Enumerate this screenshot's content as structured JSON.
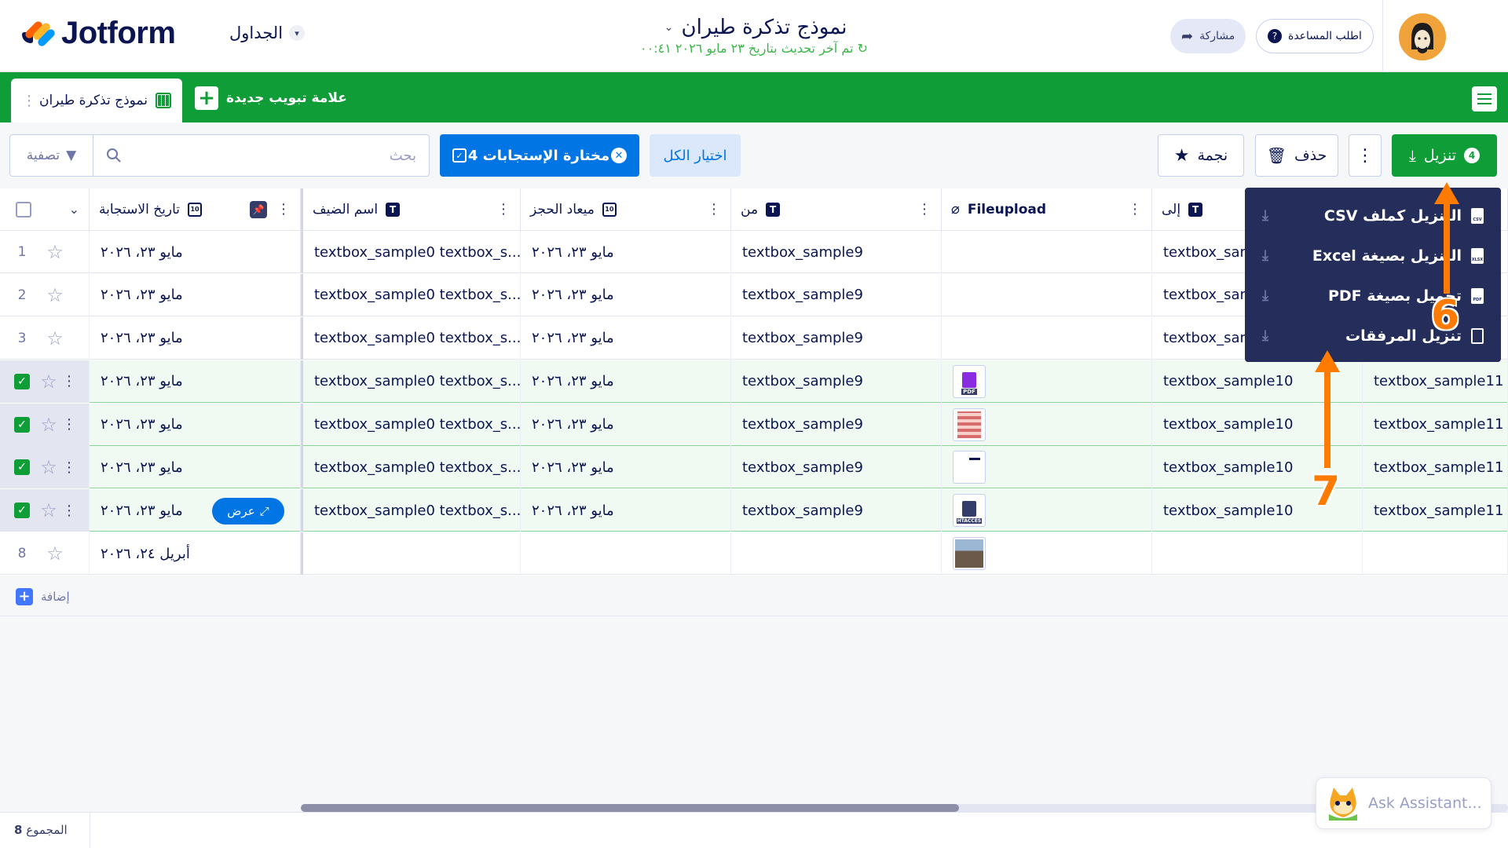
{
  "header": {
    "brand": "Jotform",
    "tables_menu": "الجداول",
    "form_title": "نموذج تذكرة طيران",
    "last_updated": "تم آخر تحديث بتاريخ ٢٣ مايو ٢٠٢٦ ٠٠:٤١",
    "share_label": "مشاركة",
    "help_label": "اطلب المساعدة"
  },
  "tabs": {
    "active_tab": "نموذج تذكرة طيران",
    "new_tab": "علامة تبويب جديدة"
  },
  "toolbar": {
    "search_placeholder": "بحث",
    "filter_label": "تصفية",
    "selected_label": "مختارة الإستجابات 4",
    "select_all_label": "اختيار الكل",
    "star_label": "نجمة",
    "delete_label": "حذف",
    "download_label": "تنزيل",
    "download_badge": "4"
  },
  "columns": {
    "response_date": "تاريخ الاستجابة",
    "guest_name": "اسم الضيف",
    "booking_date": "ميعاد الحجز",
    "from": "من",
    "fileupload": "Fileupload",
    "to": "إلى"
  },
  "rows": [
    {
      "num": "1",
      "date": "مايو ٢٣، ٢٠٢٦",
      "guest": "textbox_sample0 textbox_s...",
      "booking": "مايو ٢٣، ٢٠٢٦",
      "from": "textbox_sample9",
      "file": "",
      "to": "textbox_sam",
      "to2": "",
      "selected": false
    },
    {
      "num": "2",
      "date": "مايو ٢٣، ٢٠٢٦",
      "guest": "textbox_sample0 textbox_s...",
      "booking": "مايو ٢٣، ٢٠٢٦",
      "from": "textbox_sample9",
      "file": "",
      "to": "textbox_sam",
      "to2": "",
      "selected": false
    },
    {
      "num": "3",
      "date": "مايو ٢٣، ٢٠٢٦",
      "guest": "textbox_sample0 textbox_s...",
      "booking": "مايو ٢٣، ٢٠٢٦",
      "from": "textbox_sample9",
      "file": "",
      "to": "textbox_sam",
      "to2": "",
      "selected": false
    },
    {
      "num": "4",
      "date": "مايو ٢٣، ٢٠٢٦",
      "guest": "textbox_sample0 textbox_s...",
      "booking": "مايو ٢٣، ٢٠٢٦",
      "from": "textbox_sample9",
      "file": "PDF",
      "to": "textbox_sample10",
      "to2": "textbox_sample11",
      "selected": true
    },
    {
      "num": "5",
      "date": "مايو ٢٣، ٢٠٢٦",
      "guest": "textbox_sample0 textbox_s...",
      "booking": "مايو ٢٣، ٢٠٢٦",
      "from": "textbox_sample9",
      "file": "",
      "to": "textbox_sample10",
      "to2": "textbox_sample11",
      "selected": true
    },
    {
      "num": "6",
      "date": "مايو ٢٣، ٢٠٢٦",
      "guest": "textbox_sample0 textbox_s...",
      "booking": "مايو ٢٣، ٢٠٢٦",
      "from": "textbox_sample9",
      "file": "",
      "to": "textbox_sample10",
      "to2": "textbox_sample11",
      "selected": true
    },
    {
      "num": "7",
      "date": "مايو ٢٣، ٢٠٢٦",
      "guest": "textbox_sample0 textbox_s...",
      "booking": "مايو ٢٣، ٢٠٢٦",
      "from": "textbox_sample9",
      "file": "HTACCES",
      "to": "textbox_sample10",
      "to2": "textbox_sample11",
      "selected": true
    },
    {
      "num": "8",
      "date": "أبريل ٢٤، ٢٠٢٦",
      "guest": "",
      "booking": "",
      "from": "",
      "file": "",
      "to": "",
      "to2": "",
      "selected": false
    }
  ],
  "view_label": "عرض",
  "add_label": "إضافة",
  "footer": {
    "total_label": "المجموع",
    "total_value": "8"
  },
  "assistant_label": "Ask Assistant...",
  "download_menu": [
    {
      "label": "التنزيل كملف CSV",
      "file_tag": "CSV"
    },
    {
      "label": "التنزيل بصيغة Excel",
      "file_tag": "XLSX"
    },
    {
      "label": "تحميل بصيغة PDF",
      "file_tag": "PDF"
    },
    {
      "label": "تنزيل المرفقات",
      "file_tag": ""
    }
  ],
  "annotations": {
    "step6": "6",
    "step7": "7"
  },
  "colors": {
    "brand_green": "#0f9d37",
    "primary_blue": "#0075e3",
    "menu_navy": "#252d5b",
    "annotation_orange": "#ff7a00"
  }
}
